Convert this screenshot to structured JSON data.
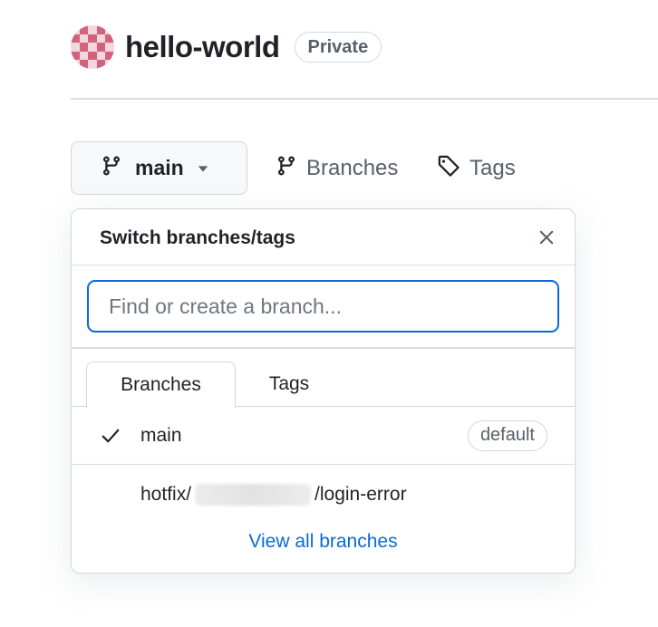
{
  "repo": {
    "name": "hello-world",
    "visibility": "Private",
    "avatar_color": "#d2637f"
  },
  "branch_bar": {
    "current_branch": "main",
    "branches_label": "Branches",
    "tags_label": "Tags"
  },
  "dropdown": {
    "title": "Switch branches/tags",
    "search_placeholder": "Find or create a branch...",
    "tabs": [
      {
        "label": "Branches",
        "active": true
      },
      {
        "label": "Tags",
        "active": false
      }
    ],
    "branches": [
      {
        "name": "main",
        "selected": true,
        "badge": "default"
      },
      {
        "name_prefix": "hotfix/",
        "name_suffix": "/login-error",
        "redacted": true
      }
    ],
    "view_all_label": "View all branches"
  },
  "colors": {
    "accent": "#0969da",
    "muted_text": "#57606a",
    "border": "#d0d7de"
  },
  "icons": [
    "git-branch-icon",
    "caret-down-icon",
    "tag-icon",
    "close-icon",
    "check-icon"
  ]
}
